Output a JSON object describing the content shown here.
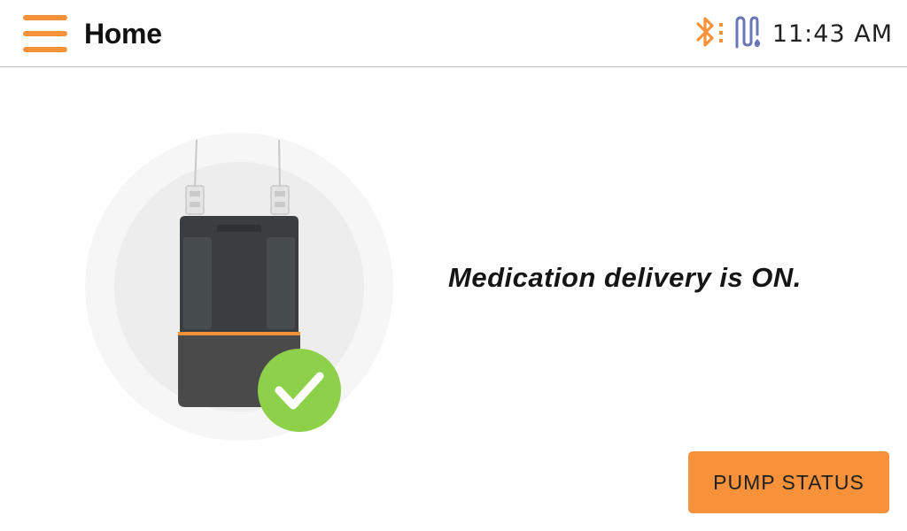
{
  "header": {
    "title": "Home",
    "time": "11:43 AM",
    "icons": {
      "menu": "hamburger-menu-icon",
      "bluetooth": "bluetooth-icon",
      "sensor": "sensor-connection-icon"
    }
  },
  "main": {
    "status_message": "Medication delivery is ON.",
    "illustration": {
      "subject": "pump-device-icon",
      "badge": "checkmark-icon"
    },
    "pump_status_button": "PUMP STATUS"
  },
  "colors": {
    "accent": "#f7923a",
    "success": "#8dd14b",
    "sensor": "#6b76b8",
    "device": "#3a3d3f"
  }
}
